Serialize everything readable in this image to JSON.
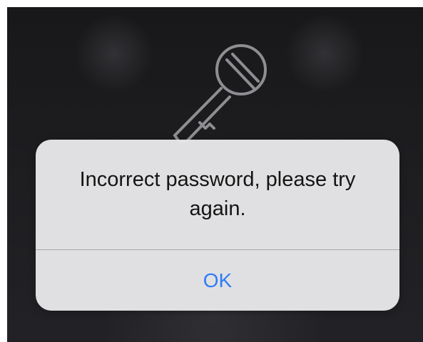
{
  "alert": {
    "message": "Incorrect password, please try again.",
    "ok_label": "OK"
  },
  "background": {
    "icon": "key-icon"
  },
  "colors": {
    "button_text": "#2f7cf6",
    "alert_background": "#e6e6e8",
    "screen_background": "#1d1d20"
  }
}
